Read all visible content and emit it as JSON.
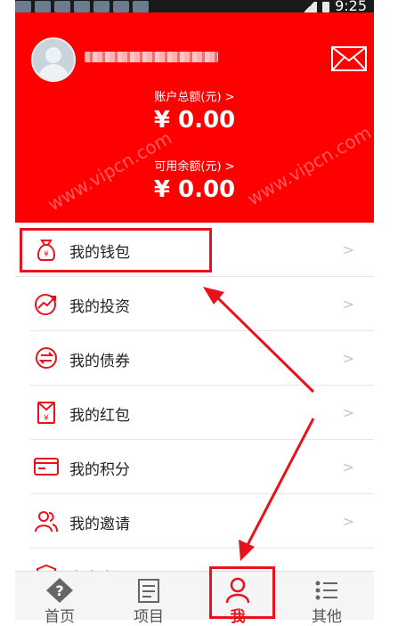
{
  "status_bar": {
    "time": "9:25"
  },
  "header": {
    "total_label": "账户总额(元) >",
    "total_amount": "¥ 0.00",
    "available_label": "可用余额(元) >",
    "available_amount": "¥ 0.00",
    "watermark": "www.vipcn.com"
  },
  "menu": [
    {
      "label": "我的钱包",
      "icon": "wallet-icon"
    },
    {
      "label": "我的投资",
      "icon": "trend-icon"
    },
    {
      "label": "我的债券",
      "icon": "transfer-icon"
    },
    {
      "label": "我的红包",
      "icon": "red-envelope-icon"
    },
    {
      "label": "我的积分",
      "icon": "card-icon"
    },
    {
      "label": "我的邀请",
      "icon": "users-icon"
    },
    {
      "label": "安全中心",
      "icon": "shield-icon"
    }
  ],
  "tabs": [
    {
      "label": "首页",
      "icon": "diamond-question-icon"
    },
    {
      "label": "项目",
      "icon": "document-icon"
    },
    {
      "label": "我",
      "icon": "person-icon",
      "active": true
    },
    {
      "label": "其他",
      "icon": "list-icon"
    }
  ],
  "colors": {
    "accent": "#ff0000",
    "highlight": "#e8121c"
  }
}
